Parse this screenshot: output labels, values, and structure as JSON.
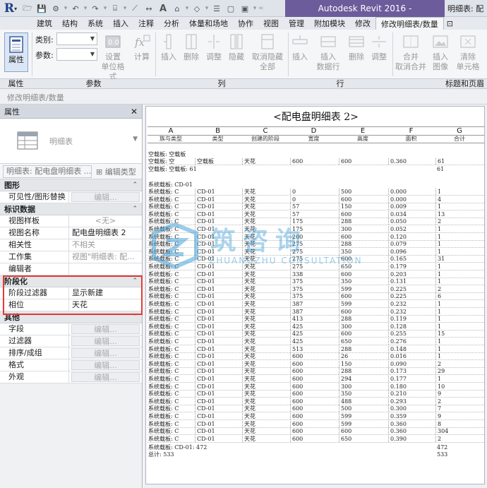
{
  "title_bar": {
    "app_title": "Autodesk Revit 2016 -",
    "doc_title": "明细表: 配"
  },
  "ribbon_tabs": [
    "建筑",
    "结构",
    "系统",
    "插入",
    "注释",
    "分析",
    "体量和场地",
    "协作",
    "视图",
    "管理",
    "附加模块",
    "修改",
    "修改明细表/数量"
  ],
  "ribbon": {
    "properties_btn": "属性",
    "category_label": "类别:",
    "params_label": "参数:",
    "set_btn": "设置",
    "unit_format": "单位格式",
    "calc_btn": "计算",
    "col_insert": "插入",
    "col_delete": "删除",
    "col_adjust": "调整",
    "col_hide": "隐藏",
    "col_unhide_1": "取消隐藏",
    "col_unhide_2": "全部",
    "row_insert": "插入",
    "row_insert_data_1": "插入",
    "row_insert_data_2": "数据行",
    "row_delete": "删除",
    "row_adjust": "调整",
    "merge_1": "合并",
    "merge_2": "取消合并",
    "insert_image_1": "插入",
    "insert_image_2": "图像",
    "clear_cell_1": "清除",
    "clear_cell_2": "单元格"
  },
  "panel_labels": {
    "properties": "属性",
    "parameters": "参数",
    "columns": "列",
    "rows": "行",
    "titles_headers": "标题和页眉"
  },
  "context_label": "修改明细表/数量",
  "properties": {
    "header": "属性",
    "type_name": "明细表",
    "selector": "明细表: 配电盘明细表 ...",
    "edit_type": "编辑类型",
    "categories": {
      "graphics": "图形",
      "identity": "标识数据",
      "phasing": "阶段化",
      "other": "其他"
    },
    "rows": {
      "visibility_key": "可见性/图形替换",
      "visibility_val": "编辑...",
      "view_template_key": "视图样板",
      "view_template_val": "<无>",
      "view_name_key": "视图名称",
      "view_name_val": "配电盘明细表 2",
      "dependency_key": "相关性",
      "dependency_val": "不相关",
      "workset_key": "工作集",
      "workset_val": "视图\"明细表: 配...",
      "edited_by_key": "编辑者",
      "edited_by_val": "",
      "phase_filter_key": "阶段过滤器",
      "phase_filter_val": "显示新建",
      "phase_key": "相位",
      "phase_val": "天花",
      "fields_key": "字段",
      "fields_val": "编辑...",
      "filter_key": "过滤器",
      "filter_val": "编辑...",
      "sort_key": "排序/成组",
      "sort_val": "编辑...",
      "format_key": "格式",
      "format_val": "编辑...",
      "appearance_key": "外观",
      "appearance_val": "编辑..."
    }
  },
  "schedule": {
    "title": "<配电盘明细表 2>",
    "columns": [
      {
        "letter": "A",
        "header": "族与类型"
      },
      {
        "letter": "B",
        "header": "类型"
      },
      {
        "letter": "C",
        "header": "创建的阶段"
      },
      {
        "letter": "D",
        "header": "宽度"
      },
      {
        "letter": "E",
        "header": "高度"
      },
      {
        "letter": "F",
        "header": "面积"
      },
      {
        "letter": "G",
        "header": "合计"
      }
    ],
    "group1_label": "空载板: 空载板",
    "group1_row": [
      "空载板: 空",
      "空载板",
      "天花",
      "600",
      "600",
      "0.360",
      "61"
    ],
    "group1_footer": "空载板: 空载板: 61",
    "group1_footer_total": "61",
    "group2_label": "系统载板: CD-01",
    "rows": [
      [
        "系统载板: C",
        "CD-01",
        "天花",
        "0",
        "500",
        "0.000",
        "1"
      ],
      [
        "系统载板: C",
        "CD-01",
        "天花",
        "0",
        "600",
        "0.000",
        "4"
      ],
      [
        "系统载板: C",
        "CD-01",
        "天花",
        "57",
        "150",
        "0.009",
        "1"
      ],
      [
        "系统载板: C",
        "CD-01",
        "天花",
        "57",
        "600",
        "0.034",
        "13"
      ],
      [
        "系统载板: C",
        "CD-01",
        "天花",
        "175",
        "288",
        "0.050",
        "2"
      ],
      [
        "系统载板: C",
        "CD-01",
        "天花",
        "175",
        "300",
        "0.052",
        "1"
      ],
      [
        "系统载板: C",
        "CD-01",
        "天花",
        "200",
        "600",
        "0.120",
        "1"
      ],
      [
        "系统载板: C",
        "CD-01",
        "天花",
        "275",
        "288",
        "0.079",
        "1"
      ],
      [
        "系统载板: C",
        "CD-01",
        "天花",
        "275",
        "350",
        "0.096",
        "1"
      ],
      [
        "系统载板: C",
        "CD-01",
        "天花",
        "275",
        "600",
        "0.165",
        "31"
      ],
      [
        "系统载板: C",
        "CD-01",
        "天花",
        "275",
        "650",
        "0.179",
        "1"
      ],
      [
        "系统载板: C",
        "CD-01",
        "天花",
        "338",
        "600",
        "0.203",
        "1"
      ],
      [
        "系统载板: C",
        "CD-01",
        "天花",
        "375",
        "350",
        "0.131",
        "1"
      ],
      [
        "系统载板: C",
        "CD-01",
        "天花",
        "375",
        "599",
        "0.225",
        "2"
      ],
      [
        "系统载板: C",
        "CD-01",
        "天花",
        "375",
        "600",
        "0.225",
        "6"
      ],
      [
        "系统载板: C",
        "CD-01",
        "天花",
        "387",
        "599",
        "0.232",
        "1"
      ],
      [
        "系统载板: C",
        "CD-01",
        "天花",
        "387",
        "600",
        "0.232",
        "1"
      ],
      [
        "系统载板: C",
        "CD-01",
        "天花",
        "413",
        "288",
        "0.119",
        "1"
      ],
      [
        "系统载板: C",
        "CD-01",
        "天花",
        "425",
        "300",
        "0.128",
        "1"
      ],
      [
        "系统载板: C",
        "CD-01",
        "天花",
        "425",
        "600",
        "0.255",
        "15"
      ],
      [
        "系统载板: C",
        "CD-01",
        "天花",
        "425",
        "650",
        "0.276",
        "1"
      ],
      [
        "系统载板: C",
        "CD-01",
        "天花",
        "513",
        "288",
        "0.148",
        "1"
      ],
      [
        "系统载板: C",
        "CD-01",
        "天花",
        "600",
        "26",
        "0.016",
        "1"
      ],
      [
        "系统载板: C",
        "CD-01",
        "天花",
        "600",
        "150",
        "0.090",
        "2"
      ],
      [
        "系统载板: C",
        "CD-01",
        "天花",
        "600",
        "288",
        "0.173",
        "29"
      ],
      [
        "系统载板: C",
        "CD-01",
        "天花",
        "600",
        "294",
        "0.177",
        "1"
      ],
      [
        "系统载板: C",
        "CD-01",
        "天花",
        "600",
        "300",
        "0.180",
        "10"
      ],
      [
        "系统载板: C",
        "CD-01",
        "天花",
        "600",
        "350",
        "0.210",
        "9"
      ],
      [
        "系统载板: C",
        "CD-01",
        "天花",
        "600",
        "488",
        "0.293",
        "2"
      ],
      [
        "系统载板: C",
        "CD-01",
        "天花",
        "600",
        "500",
        "0.300",
        "7"
      ],
      [
        "系统载板: C",
        "CD-01",
        "天花",
        "600",
        "599",
        "0.359",
        "9"
      ],
      [
        "系统载板: C",
        "CD-01",
        "天花",
        "600",
        "599",
        "0.360",
        "8"
      ],
      [
        "系统载板: C",
        "CD-01",
        "天花",
        "600",
        "600",
        "0.360",
        "304"
      ],
      [
        "系统载板: C",
        "CD-01",
        "天花",
        "600",
        "650",
        "0.390",
        "2"
      ]
    ],
    "group2_footer": "系统载板: CD-01: 472",
    "group2_footer_total": "472",
    "grand_total": "总计: 533",
    "grand_total_value": "533"
  },
  "watermark": {
    "main": "筑咨询",
    "sub": "ZHUANGZHU CONSULTATION"
  },
  "colors": {
    "title_purple": "#6d5c9b",
    "highlight_red": "#e53935",
    "watermark": "#4aa3d8"
  }
}
